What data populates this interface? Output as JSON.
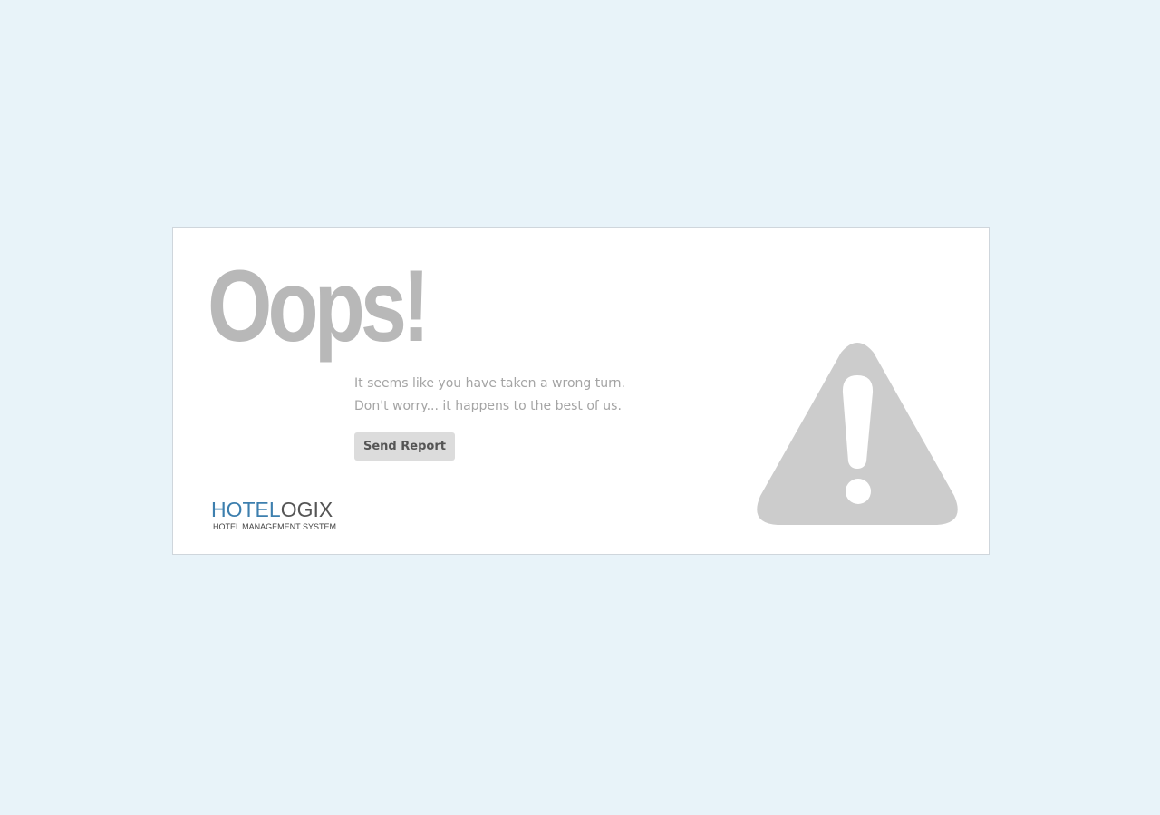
{
  "error": {
    "heading": "Oops!",
    "line1": "It seems like you have taken a wrong turn.",
    "line2": "Don't worry... it happens to the best of us.",
    "send_report_label": "Send Report"
  },
  "logo": {
    "part1": "HOTEL",
    "part2": "OGIX",
    "tagline": "HOTEL MANAGEMENT SYSTEM",
    "color_primary": "#3d7fae",
    "color_secondary": "#555555"
  },
  "icons": {
    "warning": "warning-triangle-icon"
  },
  "colors": {
    "page_background": "#e8f3f9",
    "heading": "#b8b8b8",
    "icon": "#cccccc"
  }
}
